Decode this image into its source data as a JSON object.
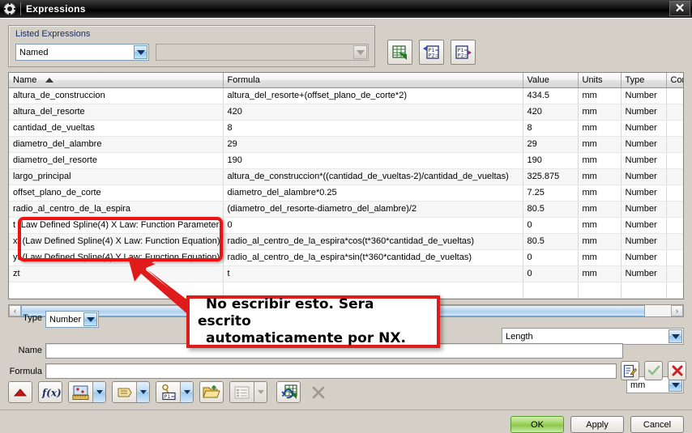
{
  "window": {
    "title": "Expressions",
    "app_icon": "gear-icon",
    "close_label": "✕"
  },
  "listed_expressions": {
    "group_label": "Listed Expressions",
    "mode_value": "Named",
    "filter_value": ""
  },
  "top_toolbar": [
    {
      "name": "export-to-spreadsheet-button",
      "icon": "spreadsheet-icon"
    },
    {
      "name": "import-expressions-button",
      "icon": "p1-p2-import-icon"
    },
    {
      "name": "export-expressions-button",
      "icon": "p1-p2-export-icon"
    }
  ],
  "table": {
    "columns": [
      "Name",
      "Formula",
      "Value",
      "Units",
      "Type",
      "Comment"
    ],
    "sort_column": "Name",
    "sort_direction": "asc",
    "rows": [
      {
        "name": "altura_de_construccion",
        "formula": "altura_del_resorte+(offset_plano_de_corte*2)",
        "value": "434.5",
        "units": "mm",
        "type": "Number",
        "comment": ""
      },
      {
        "name": "altura_del_resorte",
        "formula": "420",
        "value": "420",
        "units": "mm",
        "type": "Number",
        "comment": ""
      },
      {
        "name": "cantidad_de_vueltas",
        "formula": "8",
        "value": "8",
        "units": "mm",
        "type": "Number",
        "comment": ""
      },
      {
        "name": "diametro_del_alambre",
        "formula": "29",
        "value": "29",
        "units": "mm",
        "type": "Number",
        "comment": ""
      },
      {
        "name": "diametro_del_resorte",
        "formula": "190",
        "value": "190",
        "units": "mm",
        "type": "Number",
        "comment": ""
      },
      {
        "name": "largo_principal",
        "formula": "altura_de_construccion*((cantidad_de_vueltas-2)/cantidad_de_vueltas)",
        "value": "325.875",
        "units": "mm",
        "type": "Number",
        "comment": ""
      },
      {
        "name": "offset_plano_de_corte",
        "formula": "diametro_del_alambre*0.25",
        "value": "7.25",
        "units": "mm",
        "type": "Number",
        "comment": ""
      },
      {
        "name": "radio_al_centro_de_la_espira",
        "formula": "(diametro_del_resorte-diametro_del_alambre)/2",
        "value": "80.5",
        "units": "mm",
        "type": "Number",
        "comment": ""
      },
      {
        "name": "t  (Law Defined Spline(4) X Law: Function Parameter)",
        "formula": "0",
        "value": "0",
        "units": "mm",
        "type": "Number",
        "comment": ""
      },
      {
        "name": "xt  (Law Defined Spline(4) X Law: Function Equation)",
        "formula": "radio_al_centro_de_la_espira*cos(t*360*cantidad_de_vueltas)",
        "value": "80.5",
        "units": "mm",
        "type": "Number",
        "comment": ""
      },
      {
        "name": "yt  (Law Defined Spline(4) Y Law: Function Equation)",
        "formula": "radio_al_centro_de_la_espira*sin(t*360*cantidad_de_vueltas)",
        "value": "0",
        "units": "mm",
        "type": "Number",
        "comment": ""
      },
      {
        "name": "zt",
        "formula": "t",
        "value": "0",
        "units": "mm",
        "type": "Number",
        "comment": ""
      },
      {
        "name": "",
        "formula": "",
        "value": "",
        "units": "",
        "type": "",
        "comment": ""
      }
    ]
  },
  "scrollbar": {
    "left_arrow": "‹",
    "right_arrow": "›"
  },
  "form": {
    "type_label": "Type",
    "type_value": "Number",
    "dimension_value": "Length",
    "name_label": "Name",
    "name_value": "",
    "units_value": "mm",
    "formula_label": "Formula",
    "formula_value": ""
  },
  "formula_actions": [
    {
      "name": "formula-editor-button",
      "icon": "edit-note-icon"
    },
    {
      "name": "accept-formula-button",
      "icon": "check-icon"
    },
    {
      "name": "reject-formula-button",
      "icon": "x-red-icon"
    }
  ],
  "bottom_toolbar": [
    {
      "name": "move-up-button",
      "icon": "triangle-up-red-icon"
    },
    {
      "name": "function-button",
      "icon": "fx-icon"
    },
    {
      "name": "create-measure-button",
      "icon": "measure-icon"
    },
    {
      "name": "create-attribute-button",
      "icon": "tag-icon"
    },
    {
      "name": "create-part-expression-button",
      "icon": "p1-key-icon"
    },
    {
      "name": "open-file-button",
      "icon": "folder-open-icon"
    },
    {
      "name": "list-options-button",
      "icon": "list-icon"
    },
    {
      "name": "update-spreadsheet-button",
      "icon": "refresh-spreadsheet-icon"
    },
    {
      "name": "delete-button",
      "icon": "x-gray-icon"
    }
  ],
  "dialog_buttons": {
    "ok": "OK",
    "apply": "Apply",
    "cancel": "Cancel"
  },
  "annotations": {
    "note_text": "No escribir esto. Sera escrito automaticamente por NX.",
    "note_line1": "No escribir esto. Sera escrito",
    "note_line2": "automaticamente por NX.",
    "highlight_color": "#ee1111"
  }
}
